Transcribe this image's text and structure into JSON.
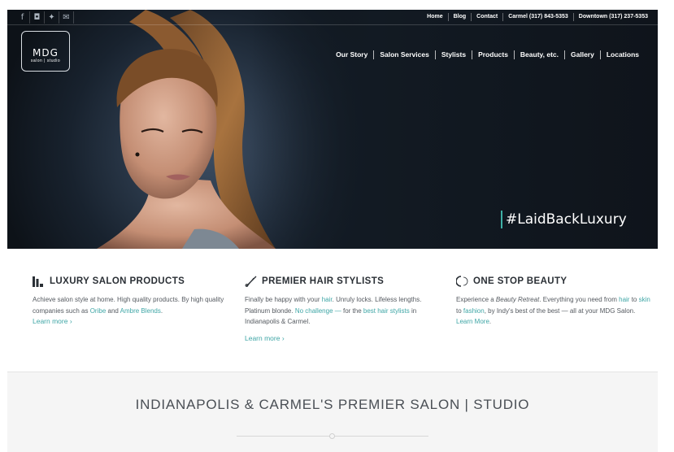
{
  "social": [
    {
      "icon": "facebook-icon",
      "glyph": "f"
    },
    {
      "icon": "instagram-icon",
      "glyph": "◘"
    },
    {
      "icon": "twitter-icon",
      "glyph": "✦"
    },
    {
      "icon": "email-icon",
      "glyph": "✉"
    }
  ],
  "top_links": [
    "Home",
    "Blog",
    "Contact",
    "Carmel (317) 843-5353",
    "Downtown (317) 237-5353"
  ],
  "logo": {
    "name": "MDG",
    "tagline": "salon | studio"
  },
  "main_nav": [
    "Our Story",
    "Salon Services",
    "Stylists",
    "Products",
    "Beauty, etc.",
    "Gallery",
    "Locations"
  ],
  "hero": {
    "hashtag": "#LaidBackLuxury"
  },
  "features": [
    {
      "title": "LUXURY SALON PRODUCTS",
      "icon": "bottles-icon",
      "body": [
        {
          "t": "Achieve salon style at home. High quality products. By high quality companies such as "
        },
        {
          "t": "Oribe",
          "hl": true
        },
        {
          "t": " and "
        },
        {
          "t": "Ambre Blends",
          "hl": true
        },
        {
          "t": "."
        }
      ],
      "learn": "Learn more ›"
    },
    {
      "title": "PREMIER HAIR STYLISTS",
      "icon": "scissors-icon",
      "body": [
        {
          "t": "Finally be happy with your "
        },
        {
          "t": "hair",
          "hl": true
        },
        {
          "t": ". Unruly locks. Lifeless lengths. Platinum blonde. "
        },
        {
          "t": "No challenge —",
          "hl": true
        },
        {
          "t": " for the "
        },
        {
          "t": "best hair stylists",
          "hl": true
        },
        {
          "t": " in Indianapolis & Carmel."
        }
      ],
      "learn": "Learn more ›"
    },
    {
      "title": "ONE STOP BEAUTY",
      "icon": "mirror-icon",
      "body": [
        {
          "t": "Experience a "
        },
        {
          "t": "Beauty Retreat",
          "it": true
        },
        {
          "t": ". Everything you need from "
        },
        {
          "t": "hair",
          "hl": true
        },
        {
          "t": " to "
        },
        {
          "t": "skin",
          "hl": true
        },
        {
          "t": " to "
        },
        {
          "t": "fashion",
          "hl": true
        },
        {
          "t": ", by Indy's best of the best — all at your MDG Salon. "
        },
        {
          "t": "Learn More",
          "hl": true
        },
        {
          "t": "."
        }
      ],
      "learn": ""
    }
  ],
  "band": {
    "title": "INDIANAPOLIS & CARMEL'S PREMIER SALON | STUDIO"
  },
  "colors": {
    "accent": "#3fa6a6",
    "hashtag_bar": "#3fb1a6"
  }
}
